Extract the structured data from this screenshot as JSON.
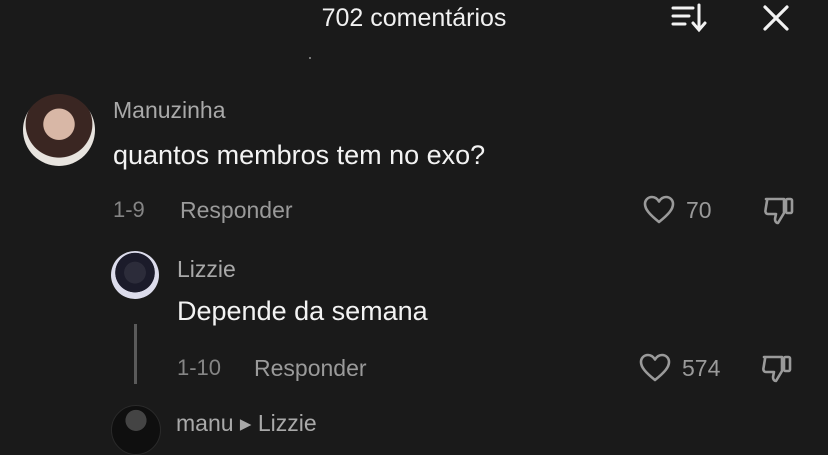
{
  "header": {
    "title": "702 comentários"
  },
  "comments": [
    {
      "username": "Manuzinha",
      "text": "quantos membros tem no exo?",
      "date": "1-9",
      "reply_label": "Responder",
      "likes": "70"
    }
  ],
  "replies": [
    {
      "username": "Lizzie",
      "text": "Depende da semana",
      "date": "1-10",
      "reply_label": "Responder",
      "likes": "574"
    }
  ],
  "next_reply": {
    "header": "manu ▸ Lizzie"
  },
  "icons": {
    "sort": "sort-icon",
    "close": "close-icon",
    "like": "heart-outline-icon",
    "dislike": "thumbs-down-icon"
  },
  "colors": {
    "background": "#1a1a1a",
    "text_primary": "#f3f3f3",
    "text_secondary": "#9a9a9a"
  }
}
